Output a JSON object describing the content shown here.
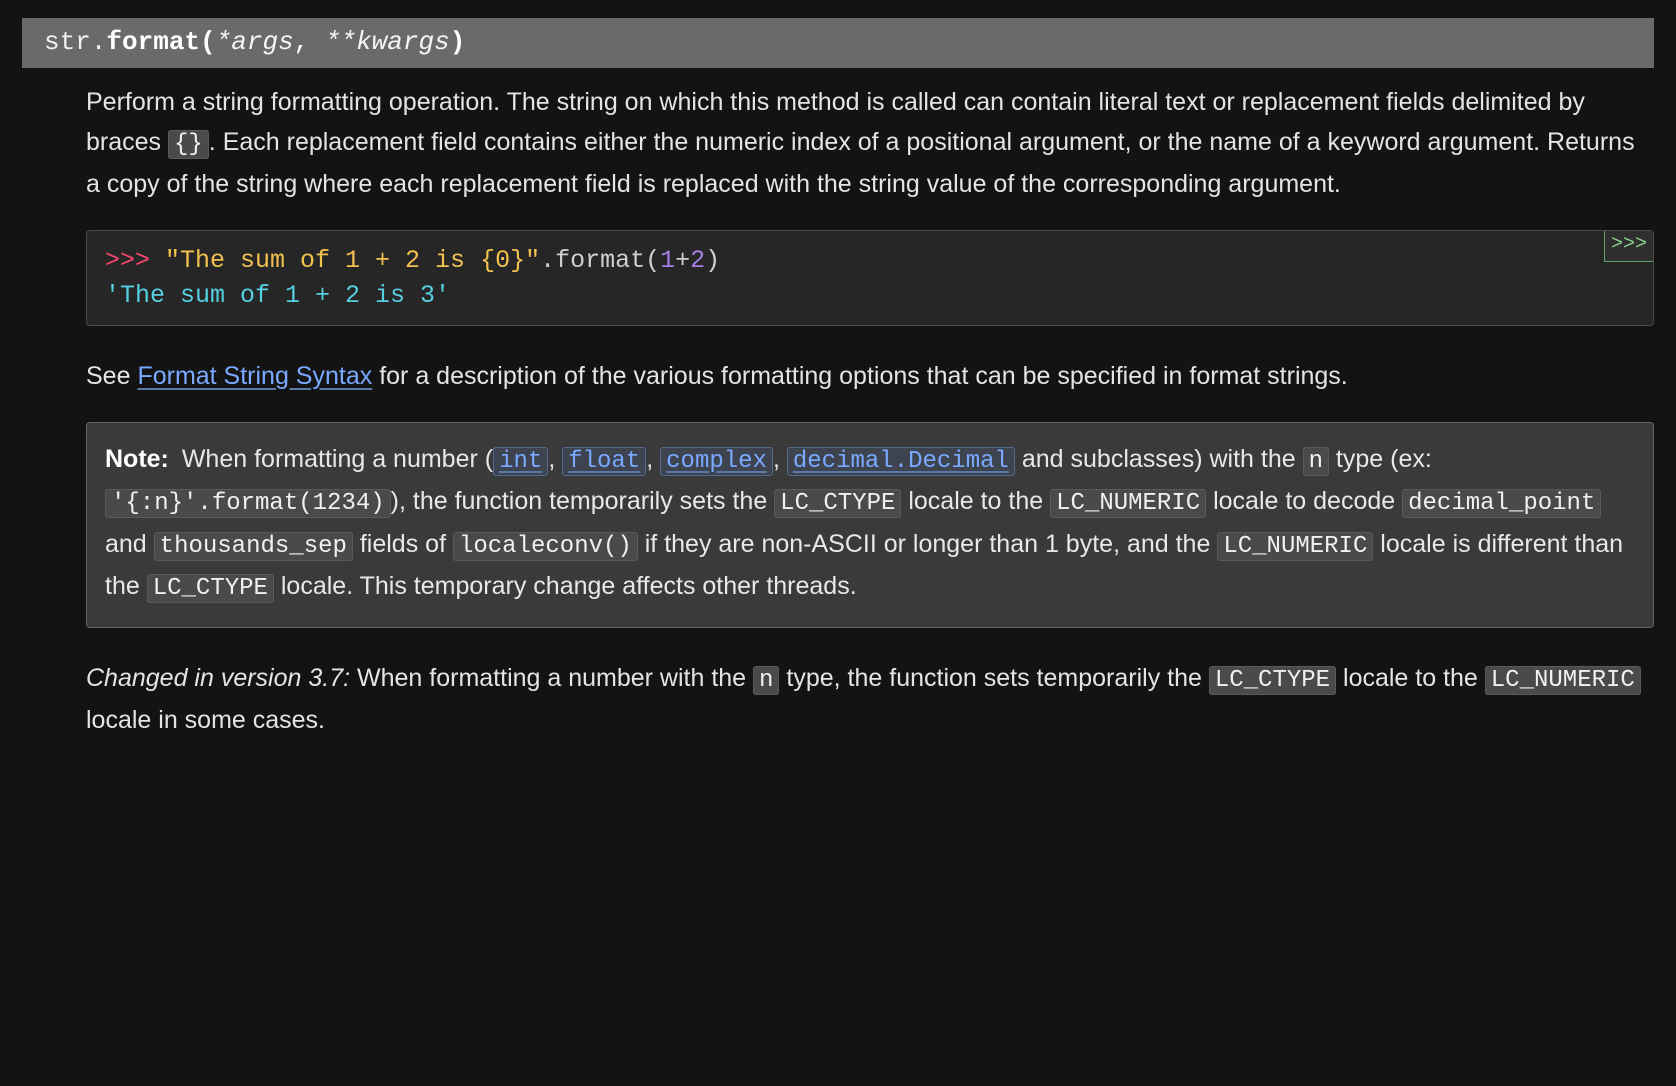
{
  "signature": {
    "classname": "str.",
    "funcname": "format",
    "open": "(",
    "args": "*args",
    "sep": ", ",
    "kwargs": "**kwargs",
    "close": ")"
  },
  "description": {
    "para1_a": "Perform a string formatting operation. The string on which this method is called can contain literal text or replacement fields delimited by braces ",
    "braces": "{}",
    "para1_b": ". Each replacement field contains either the numeric index of a positional argument, or the name of a keyword argument. Returns a copy of the string where each replacement field is replaced with the string value of the corresponding argument."
  },
  "code": {
    "toggle": ">>>",
    "prompt": ">>> ",
    "string": "\"The sum of 1 + 2 is {0}\"",
    "dot": ".",
    "call": "format",
    "open": "(",
    "n1": "1",
    "op": "+",
    "n2": "2",
    "close": ")",
    "output": "'The sum of 1 + 2 is 3'"
  },
  "see": {
    "pre": "See ",
    "link": "Format String Syntax",
    "post": " for a description of the various formatting options that can be specified in format strings."
  },
  "note": {
    "label": "Note:",
    "a": " When formatting a number (",
    "int": "int",
    "sep1": ", ",
    "float": "float",
    "sep2": ", ",
    "complex": "complex",
    "sep3": ", ",
    "decimal": "decimal.Decimal",
    "b": " and subclasses) with the ",
    "n": "n",
    "c": " type (ex: ",
    "ex": "'{:n}'.format(1234)",
    "d": "), the function temporarily sets the ",
    "lc_ctype1": "LC_CTYPE",
    "e": " locale to the ",
    "lc_numeric1": "LC_NUMERIC",
    "f": " locale to decode ",
    "decpoint": "decimal_point",
    "g": " and ",
    "thsep": "thousands_sep",
    "h": " fields of ",
    "localeconv": "localeconv()",
    "i": " if they are non-ASCII or longer than 1 byte, and the ",
    "lc_numeric2": "LC_NUMERIC",
    "j": " locale is different than the ",
    "lc_ctype2": "LC_CTYPE",
    "k": " locale. This temporary change affects other threads."
  },
  "changed": {
    "lead": "Changed in version 3.7: ",
    "a": "When formatting a number with the ",
    "n": "n",
    "b": " type, the function sets temporarily the ",
    "lc_ctype": "LC_CTYPE",
    "c": " locale to the ",
    "lc_numeric": "LC_NUMERIC",
    "d": " locale in some cases."
  }
}
